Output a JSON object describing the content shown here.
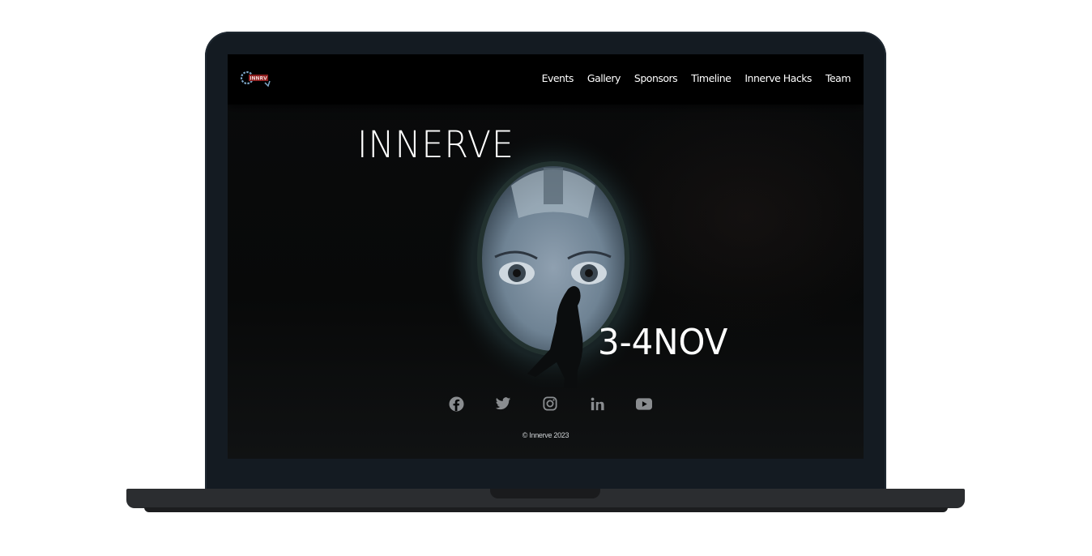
{
  "nav": {
    "links": [
      "Events",
      "Gallery",
      "Sponsors",
      "Timeline",
      "Innerve Hacks",
      "Team"
    ]
  },
  "hero": {
    "title": "INNERVE",
    "date": "3-4NOV"
  },
  "socials": [
    "facebook-icon",
    "twitter-icon",
    "instagram-icon",
    "linkedin-icon",
    "youtube-icon"
  ],
  "footer": {
    "copyright": "© Innerve 2023"
  },
  "colors": {
    "background": "#050607",
    "text": "#ffffff",
    "icon": "#8a8d90",
    "laptop_frame": "#141b22"
  }
}
